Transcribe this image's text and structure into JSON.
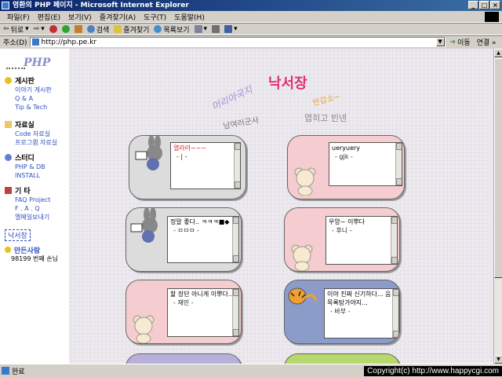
{
  "window": {
    "title": "영환의 PHP 페이지 - Microsoft Internet Explorer"
  },
  "menu": [
    "파일(F)",
    "편집(E)",
    "보기(V)",
    "즐겨찾기(A)",
    "도구(T)",
    "도움말(H)"
  ],
  "toolbar": {
    "back": "뒤로",
    "search": "검색",
    "favorites": "즐겨찾기",
    "history": "목록보기"
  },
  "address": {
    "label": "주소(D)",
    "url": "http://php.pe.kr",
    "go": "이동",
    "links": "연결 »"
  },
  "sidebar": {
    "logo": "PHP",
    "sections": [
      {
        "title": "게시판",
        "links": [
          "이야기 게시판",
          "Q & A",
          "Tip & Tech"
        ]
      },
      {
        "title": "자료실",
        "links": [
          "Code 자료실",
          "프로그램 자료실"
        ]
      },
      {
        "title": "스터디",
        "links": [
          "PHP & DB",
          "INSTALL"
        ]
      },
      {
        "title": "기 타",
        "links": [
          "FAQ Project",
          "F . A . Q",
          "멜메일보내기"
        ]
      }
    ],
    "guestbook": "낙서장",
    "maker": "만든사람",
    "visitor": "98199 번째 손님"
  },
  "header_art": {
    "title": "낙서장",
    "t1": "머리아국지",
    "t3": "남여러군사",
    "t4": "반갑소~",
    "t5": "엽히고 빈넨"
  },
  "cards": [
    {
      "msg": "열라라~~~",
      "author": "- | -",
      "red": true
    },
    {
      "msg": "ueryuery",
      "author": "- gjk -",
      "red": false
    },
    {
      "msg": "정말 좋다.. ㅋㅋㅋ■◆",
      "author": "- ㅁㅁㅁ -",
      "red": false
    },
    {
      "msg": "우앙~ 이뿌다",
      "author": "- 후니 -",
      "red": false
    },
    {
      "msg": "할 장단 아니게 이뿌다..",
      "author": "- 재민 -",
      "red": false
    },
    {
      "msg": "이야 진짜 신기하다... 음 목록탕가야지...",
      "author": "- 바부 -",
      "red": false
    }
  ],
  "status": {
    "text": "완료",
    "copyright": "Copyright(c) http://www.happycgi.com"
  },
  "colors": {
    "gray": "#dcdcdc",
    "pink": "#f5cdd0",
    "blue": "#8c9cc8",
    "purple": "#b8b0dc",
    "green": "#b6d86c"
  }
}
